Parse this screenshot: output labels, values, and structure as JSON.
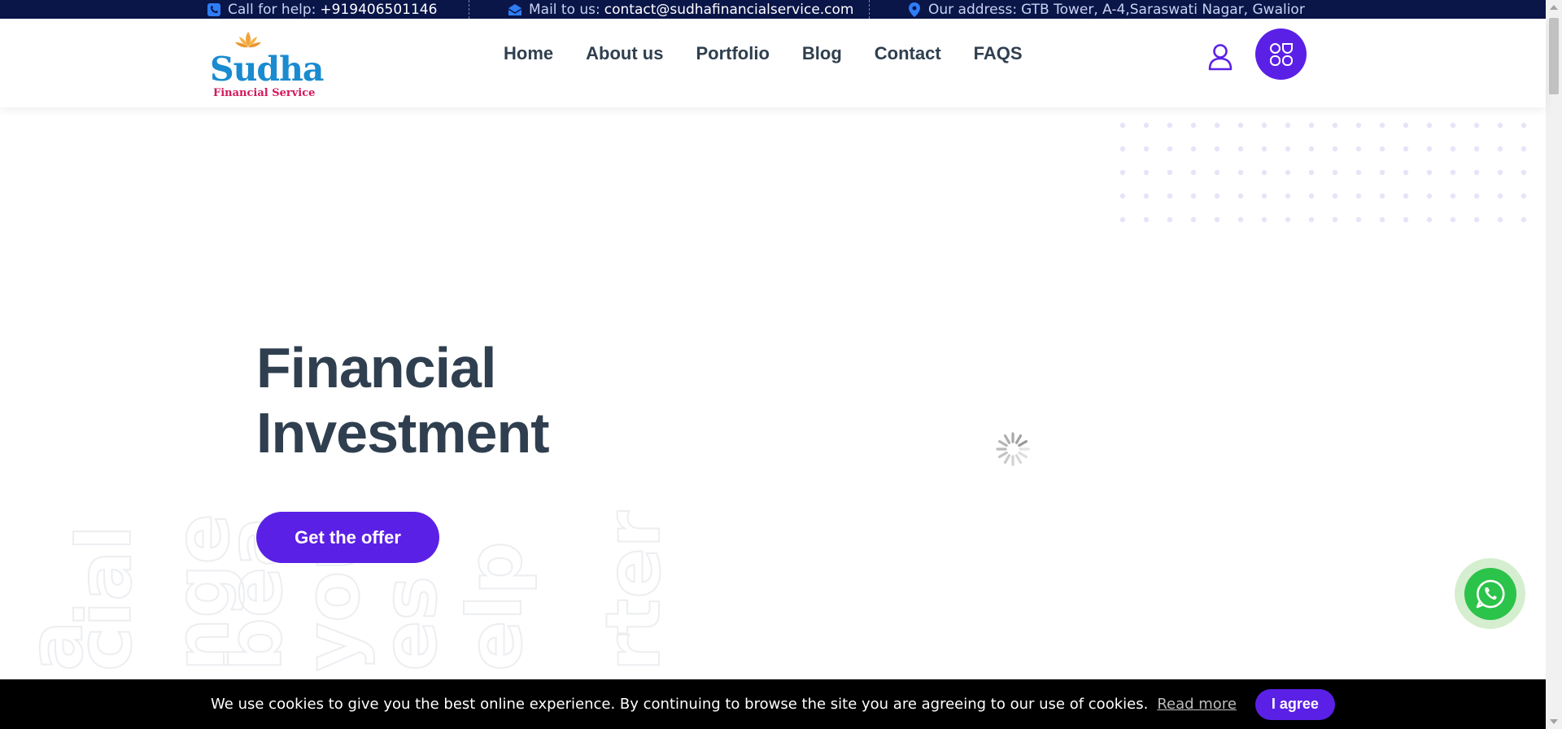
{
  "topbar": {
    "phone": {
      "label": "Call for help:",
      "value": "+919406501146",
      "icon": "phone-icon"
    },
    "mail": {
      "label": "Mail to us:",
      "value": "contact@sudhafinancialservice.com",
      "icon": "envelope-icon"
    },
    "address": {
      "label": "Our address:",
      "value": "GTB Tower, A-4,Saraswati Nagar, Gwalior",
      "icon": "map-pin-icon"
    }
  },
  "logo": {
    "name": "Sudha",
    "tagline": "Financial Service"
  },
  "nav": [
    "Home",
    "About us",
    "Portfolio",
    "Blog",
    "Contact",
    "FAQS"
  ],
  "header_icons": {
    "user": "user-icon",
    "apps": "apps-grid-icon"
  },
  "hero": {
    "title_line1": "Financial",
    "title_line2": "Investment",
    "cta": "Get the offer"
  },
  "background_words": [
    "a",
    "cial",
    "nge",
    "bea",
    "you",
    "es",
    "elp",
    "rter"
  ],
  "cookie": {
    "message": "We use cookies to give you the best online experience. By continuing to browse the site you are agreeing to our use of cookies.",
    "read_more": "Read more",
    "agree": "I agree"
  },
  "colors": {
    "accent": "#5b20e6",
    "topbar": "#0a1548",
    "text": "#2f3f4f",
    "whatsapp": "#2bc34a"
  }
}
